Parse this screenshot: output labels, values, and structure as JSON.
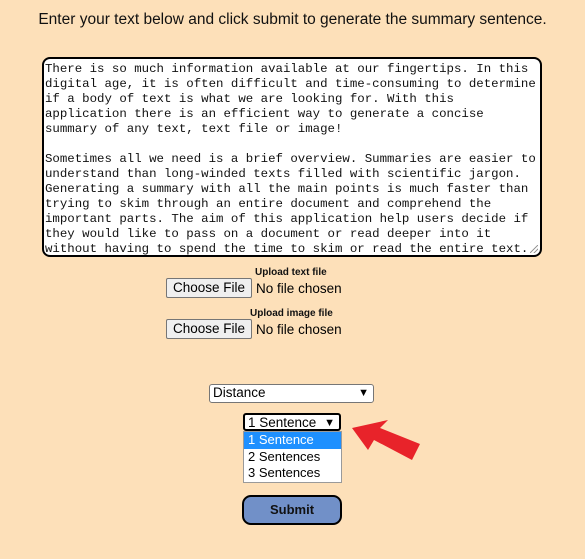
{
  "heading": "Enter your text below and click submit to generate the summary sentence.",
  "textarea": {
    "value": "There is so much information available at our fingertips. In this digital age, it is often difficult and time-consuming to determine if a body of text is what we are looking for. With this application there is an efficient way to generate a concise summary of any text, text file or image!\n\nSometimes all we need is a brief overview. Summaries are easier to understand than long-winded texts filled with scientific jargon. Generating a summary with all the main points is much faster than trying to skim through an entire document and comprehend the important parts. The aim of this application help users decide if they would like to pass on a document or read deeper into it without having to spend the time to skim or read the entire text."
  },
  "uploads": {
    "text_file": {
      "label": "Upload text file",
      "button": "Choose File",
      "status": "No file chosen"
    },
    "image_file": {
      "label": "Upload image file",
      "button": "Choose File",
      "status": "No file chosen"
    }
  },
  "method_select": {
    "value": "Distance"
  },
  "length_select": {
    "value": "1 Sentence",
    "options": [
      "1 Sentence",
      "2 Sentences",
      "3 Sentences"
    ],
    "highlighted_index": 0
  },
  "submit_label": "Submit",
  "annotation": {
    "arrow_color": "#e8232a"
  },
  "colors": {
    "background": "#fde0b9",
    "submit_bg": "#7190c8",
    "option_highlight": "#1e90ff"
  }
}
